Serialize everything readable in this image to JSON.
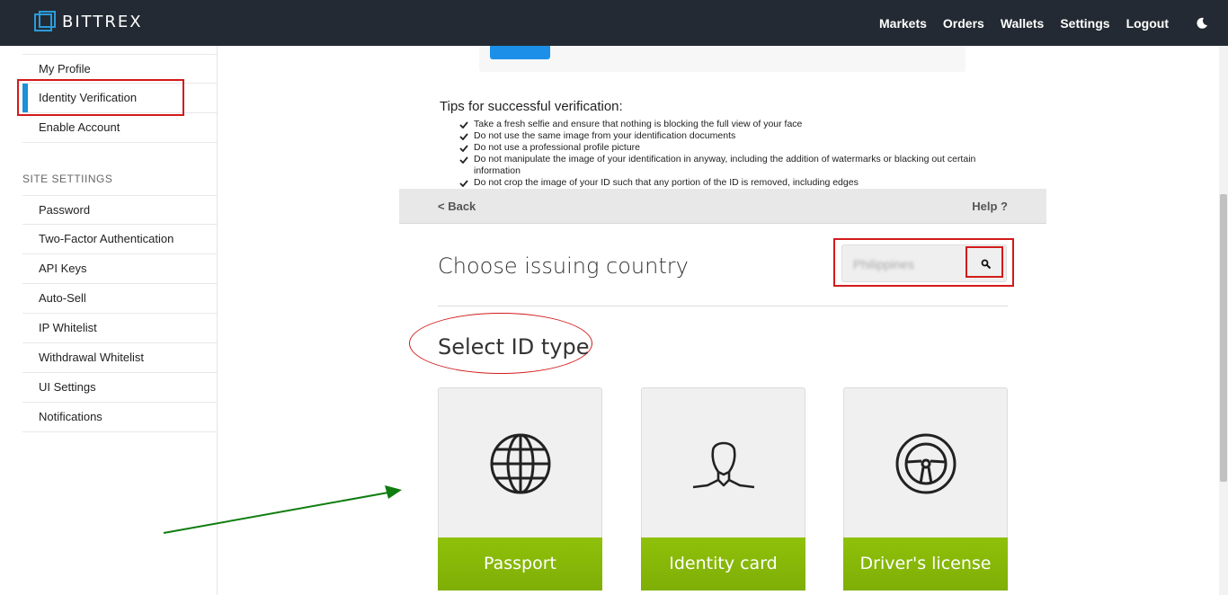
{
  "brand": {
    "name": "BITTREX",
    "logo": "bittrex-logo-icon"
  },
  "nav": {
    "items": [
      "Markets",
      "Orders",
      "Wallets",
      "Settings",
      "Logout"
    ],
    "theme_icon": "moon-icon"
  },
  "sidebar": {
    "account_items": [
      "My Profile",
      "Identity Verification",
      "Enable Account"
    ],
    "active_item": "Identity Verification",
    "section_title": "SITE SETTIINGS",
    "settings_items": [
      "Password",
      "Two-Factor Authentication",
      "API Keys",
      "Auto-Sell",
      "IP Whitelist",
      "Withdrawal Whitelist",
      "UI Settings",
      "Notifications"
    ]
  },
  "tips": {
    "title": "Tips for successful verification:",
    "items": [
      "Take a fresh selfie and ensure that nothing is blocking the full view of your face",
      "Do not use the same image from your identification documents",
      "Do not use a professional profile picture",
      "Do not manipulate the image of your identification in anyway, including the addition of watermarks or blacking out certain information",
      "Do not crop the image of your ID such that any portion of the ID is removed, including edges"
    ]
  },
  "widget": {
    "back_label": "< Back",
    "help_label": "Help ?",
    "choose_country_title": "Choose issuing country",
    "country_value": "Philippines",
    "select_id_title": "Select ID type",
    "id_types": [
      "Passport",
      "Identity card",
      "Driver's license"
    ]
  },
  "colors": {
    "topbar": "#242a33",
    "accent_blue": "#1c90d8",
    "id_button_green": "#86b808",
    "annotation_red": "#d31a1a",
    "annotation_green": "#0f7d0f"
  }
}
